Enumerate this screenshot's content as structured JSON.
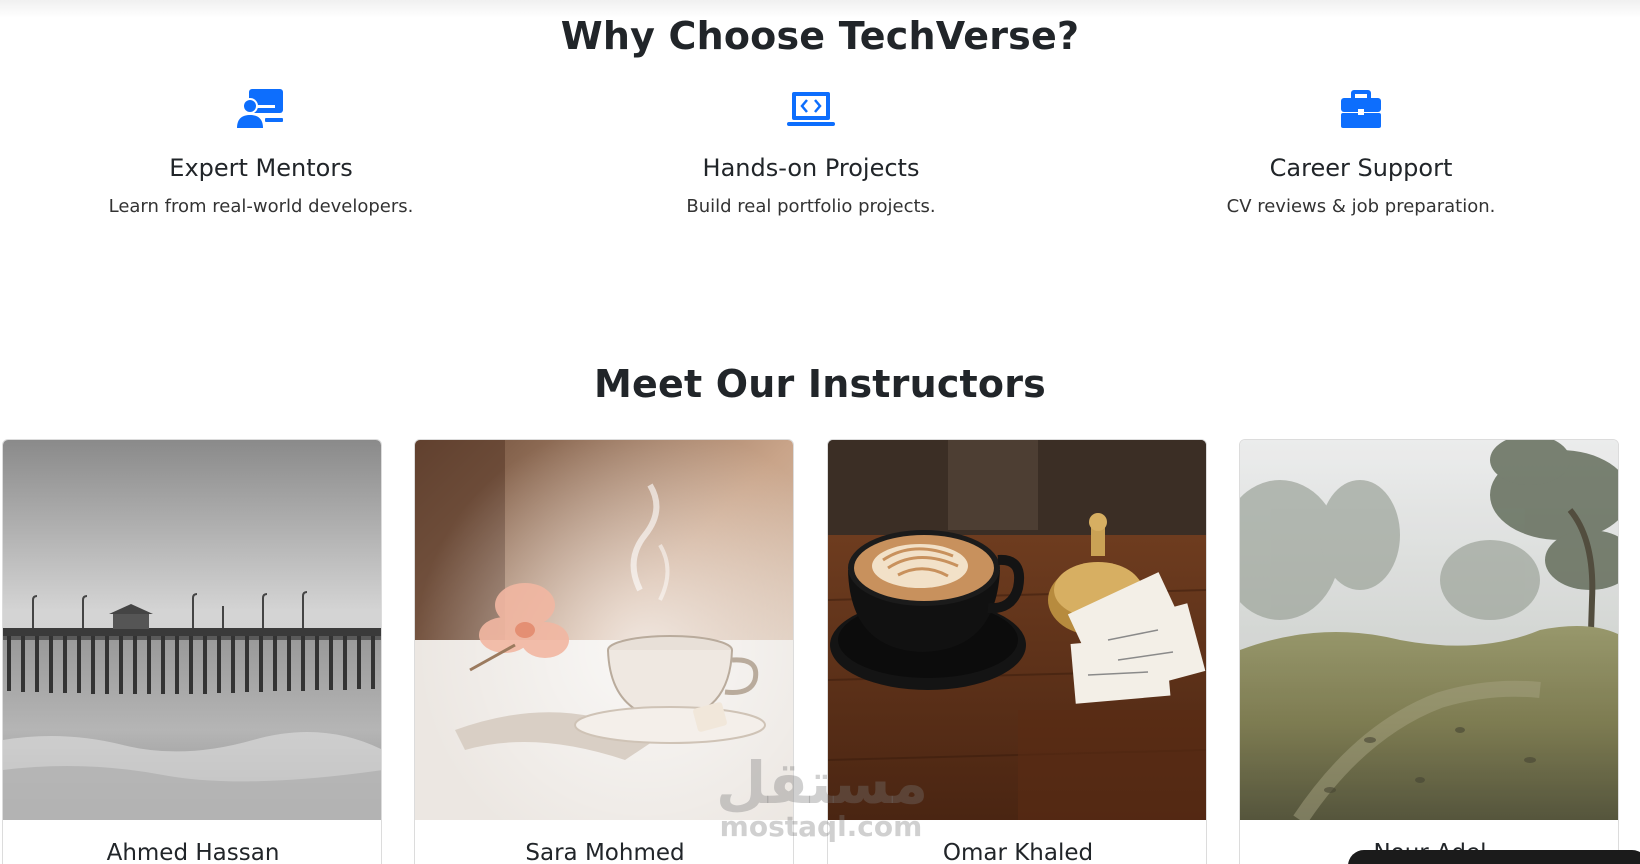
{
  "why_section": {
    "title": "Why Choose TechVerse?",
    "features": [
      {
        "icon": "person-video-icon",
        "title": "Expert Mentors",
        "description": "Learn from real-world developers."
      },
      {
        "icon": "laptop-code-icon",
        "title": "Hands-on Projects",
        "description": "Build real portfolio projects."
      },
      {
        "icon": "briefcase-icon",
        "title": "Career Support",
        "description": "CV reviews & job preparation."
      }
    ]
  },
  "instructors_section": {
    "title": "Meet Our Instructors",
    "instructors": [
      {
        "name": "Ahmed Hassan",
        "photo": "pier-photo"
      },
      {
        "name": "Sara Mohmed",
        "photo": "tea-cup-photo"
      },
      {
        "name": "Omar Khaled",
        "photo": "coffee-photo"
      },
      {
        "name": "Nour Adel",
        "photo": "foggy-hill-photo"
      }
    ]
  },
  "watermark": {
    "arabic": "مستقل",
    "latin": "mostaql.com"
  },
  "colors": {
    "accent": "#0d6efd",
    "text": "#212529"
  }
}
